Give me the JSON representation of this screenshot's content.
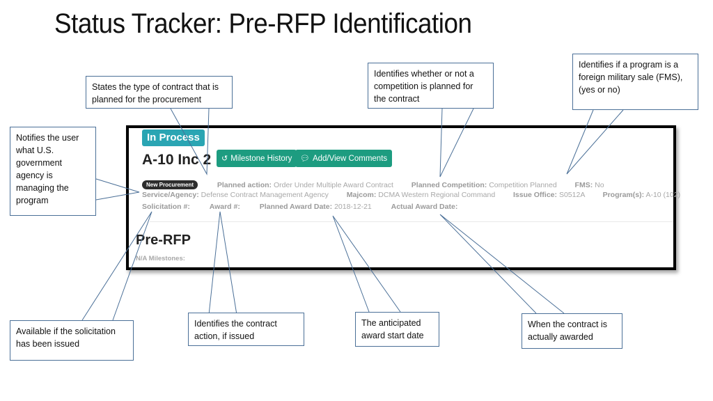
{
  "slide": {
    "title": "Status Tracker: Pre-RFP Identification"
  },
  "screenshot": {
    "status_badge": "In Process",
    "program_title": "A-10 Inc 2",
    "buttons": {
      "milestone_history": {
        "label": "Milestone History",
        "icon": "history-icon"
      },
      "add_view_comments": {
        "label": "Add/View Comments",
        "icon": "comments-icon"
      }
    },
    "procurement_pill": "New Procurement",
    "fields": {
      "planned_action": {
        "label": "Planned action:",
        "value": "Order Under Multiple Award Contract"
      },
      "planned_competition": {
        "label": "Planned Competition:",
        "value": "Competition Planned"
      },
      "fms": {
        "label": "FMS:",
        "value": "No"
      },
      "service_agency": {
        "label": "Service/Agency:",
        "value": "Defense Contract Management Agency"
      },
      "majcom": {
        "label": "Majcom:",
        "value": "DCMA Western Regional Command"
      },
      "issue_office": {
        "label": "Issue Office:",
        "value": "S0512A"
      },
      "programs": {
        "label": "Program(s):",
        "value": "A-10 (102)"
      },
      "solicitation": {
        "label": "Solicitation #:",
        "value": ""
      },
      "award": {
        "label": "Award #:",
        "value": ""
      },
      "planned_award_date": {
        "label": "Planned Award Date:",
        "value": "2018-12-21"
      },
      "actual_award_date": {
        "label": "Actual Award Date:",
        "value": ""
      }
    },
    "section_title": "Pre-RFP",
    "milestones_label": "N/A Milestones:"
  },
  "callouts": {
    "contract_type": "States the type of contract that is planned for the procurement",
    "competition": "Identifies whether or not a competition is planned for the contract",
    "fms": "Identifies if a program is a foreign military sale (FMS), (yes or no)",
    "agency": "Notifies the user what U.S. government agency is managing the program",
    "solicitation": "Available if the solicitation has been issued",
    "award": "Identifies the contract action, if issued",
    "planned_award_date": "The anticipated award start date",
    "actual_award_date": "When the contract is actually awarded"
  },
  "colors": {
    "status_badge": "#2aa5b3",
    "action_buttons": "#1d9c80",
    "callout_border": "#4a6f97"
  }
}
